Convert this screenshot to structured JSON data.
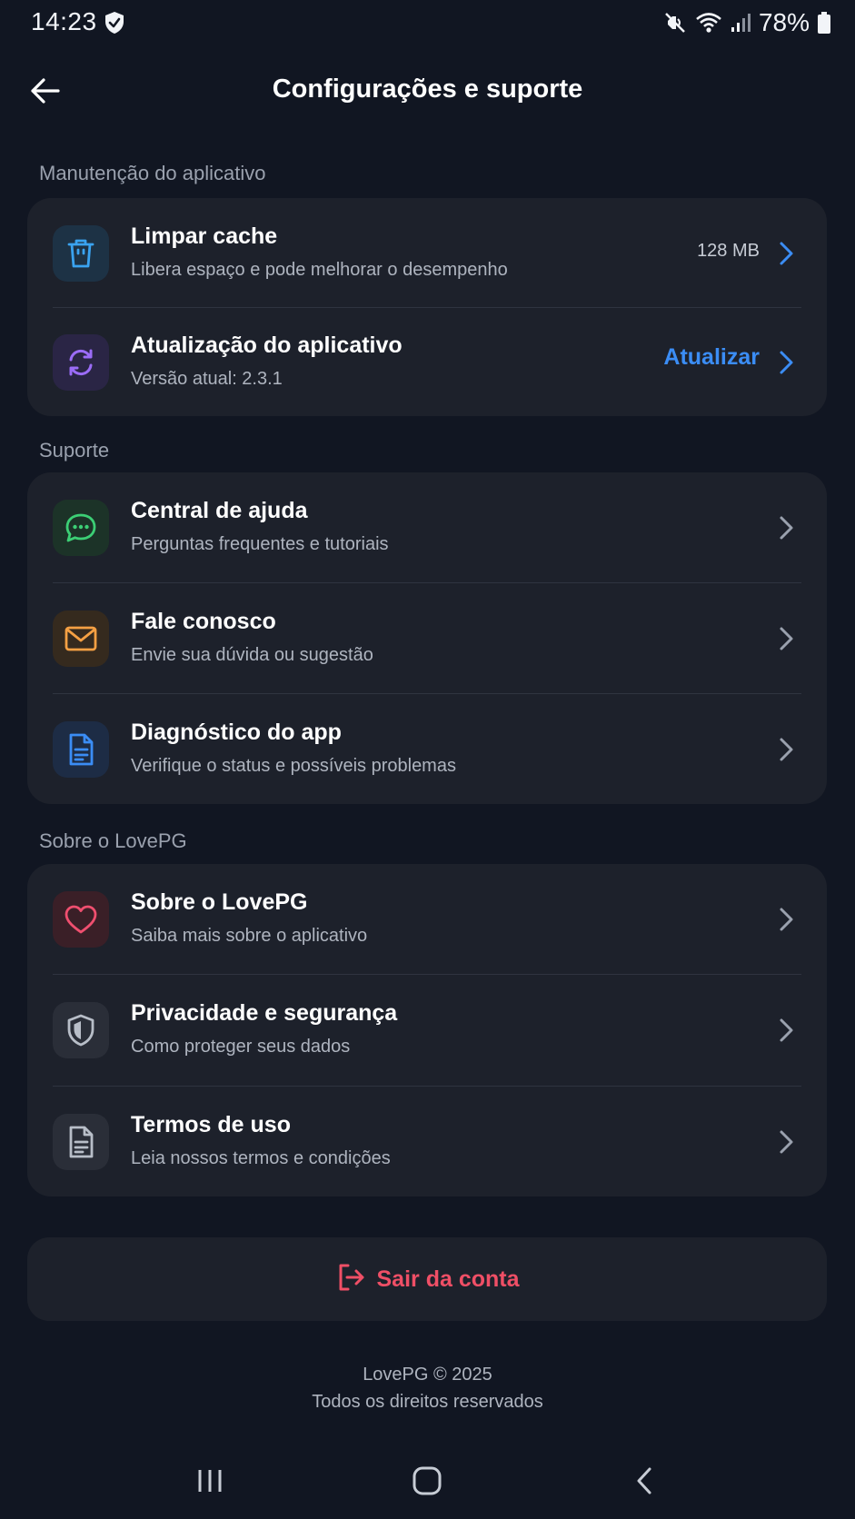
{
  "status_bar": {
    "time": "14:23",
    "battery": "78%",
    "icons": [
      "shield-check-icon",
      "mute-icon",
      "wifi-icon",
      "signal-icon",
      "battery-icon"
    ]
  },
  "header": {
    "title": "Configurações e suporte",
    "back_icon": "arrow-left-icon"
  },
  "sections": {
    "maintenance": {
      "label": "Manutenção do aplicativo",
      "items": [
        {
          "title": "Limpar cache",
          "subtitle": "Libera espaço e pode melhorar o desempenho",
          "value": "128 MB",
          "icon": "trash-icon"
        },
        {
          "title": "Atualização do aplicativo",
          "subtitle": "Versão atual: 2.3.1",
          "action": "Atualizar",
          "icon": "refresh-icon"
        }
      ]
    },
    "support": {
      "label": "Suporte",
      "items": [
        {
          "title": "Central de ajuda",
          "subtitle": "Perguntas frequentes e tutoriais",
          "icon": "chat-icon"
        },
        {
          "title": "Fale conosco",
          "subtitle": "Envie sua dúvida ou sugestão",
          "icon": "mail-icon"
        },
        {
          "title": "Diagnóstico do app",
          "subtitle": "Verifique o status e possíveis problemas",
          "icon": "document-icon"
        }
      ]
    },
    "about": {
      "label": "Sobre o LovePG",
      "items": [
        {
          "title": "Sobre o LovePG",
          "subtitle": "Saiba mais sobre o aplicativo",
          "icon": "heart-icon"
        },
        {
          "title": "Privacidade e segurança",
          "subtitle": "Como proteger seus dados",
          "icon": "shield-icon"
        },
        {
          "title": "Termos de uso",
          "subtitle": "Leia nossos termos e condições",
          "icon": "terms-icon"
        }
      ]
    }
  },
  "logout": {
    "label": "Sair da conta",
    "icon": "logout-icon"
  },
  "footer": {
    "line1": "LovePG © 2025",
    "line2": "Todos os direitos reservados"
  },
  "nav_bar": {
    "icons": [
      "recent-apps-icon",
      "home-icon",
      "back-icon"
    ]
  },
  "colors": {
    "background": "#111622",
    "card": "#1d212b",
    "accent_blue": "#3b8df5",
    "danger": "#ef4f66",
    "green": "#3ccf75",
    "orange": "#f5a043",
    "purple": "#9b6cf7",
    "pink": "#ef4f6f"
  }
}
